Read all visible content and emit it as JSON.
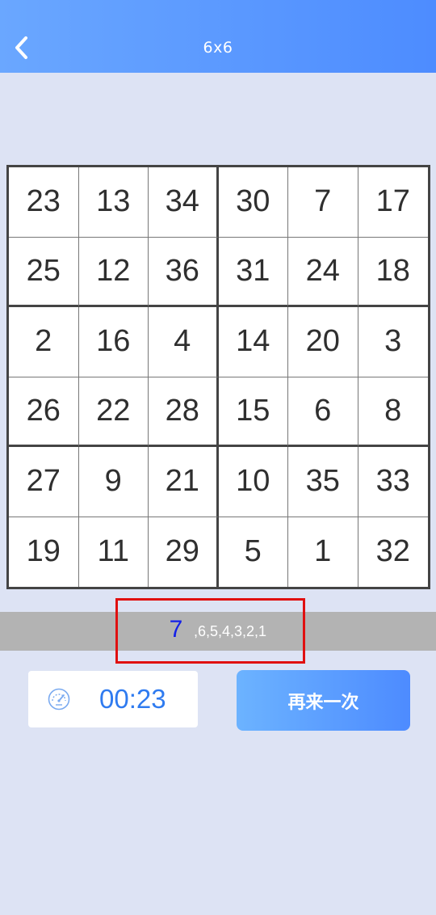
{
  "header": {
    "title": "6x6"
  },
  "grid": [
    [
      "23",
      "13",
      "34",
      "30",
      "7",
      "17"
    ],
    [
      "25",
      "12",
      "36",
      "31",
      "24",
      "18"
    ],
    [
      "2",
      "16",
      "4",
      "14",
      "20",
      "3"
    ],
    [
      "26",
      "22",
      "28",
      "15",
      "6",
      "8"
    ],
    [
      "27",
      "9",
      "21",
      "10",
      "35",
      "33"
    ],
    [
      "19",
      "11",
      "29",
      "5",
      "1",
      "32"
    ]
  ],
  "sequence": {
    "current": "7",
    "remaining": ",6,5,4,3,2,1"
  },
  "timer": {
    "value": "00:23",
    "icon": "speedometer-icon"
  },
  "retry_button": {
    "label": "再来一次"
  },
  "colors": {
    "header_start": "#6aa7ff",
    "header_end": "#4d8cff",
    "background": "#dde3f4",
    "current_number": "#1521e8",
    "highlight_border": "#e01010",
    "timer_text": "#2f7bf0"
  }
}
